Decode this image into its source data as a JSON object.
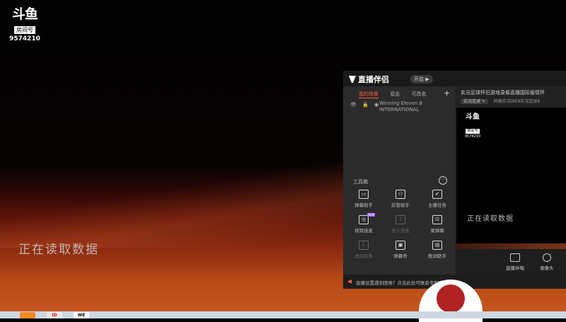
{
  "stream": {
    "logo_glyph": "斗鱼",
    "room_badge": "房间号",
    "room_number": "9574210",
    "loading_text": "正在读取数据"
  },
  "companion": {
    "brand": "直播伴侣",
    "brand_tag": "开启 ▶",
    "tabs": [
      "我的场景",
      "双击",
      "可改名"
    ],
    "add_label": "+",
    "scene_icons": "👁 🔒 ◉",
    "scene_name": "Winning Eleven 8 INTERNATIONAL",
    "toolbox_label": "工具箱",
    "toolbox_more": "···",
    "tools": [
      {
        "label": "弹幕助手",
        "icon": "▭",
        "enabled": true
      },
      {
        "label": "房管助手",
        "icon": "⚇",
        "enabled": true
      },
      {
        "label": "主播任务",
        "icon": "✔",
        "enabled": true
      },
      {
        "label": "视频连麦",
        "icon": "◎",
        "enabled": true,
        "badge": "NEW"
      },
      {
        "label": "多人连麦",
        "icon": "⇩",
        "enabled": false
      },
      {
        "label": "录弹幕",
        "icon": "⊡",
        "enabled": true
      },
      {
        "label": "虚拟形象",
        "icon": "⇩",
        "enabled": false
      },
      {
        "label": "弹幕秀",
        "icon": "▣",
        "enabled": true
      },
      {
        "label": "歌词助手",
        "icon": "▤",
        "enabled": true
      }
    ],
    "notice": "直播设置遇到困难？点击此处可联系专职客服",
    "room_title": "实况足球怀旧游戏录像直播国际版情怀",
    "category_tag": "实况足球 ✎",
    "room_subtitle": "同类实况WE8实况足球8",
    "preview_loading": "正在读取数据",
    "bottom_buttons": [
      "直播伴唱",
      "录像头"
    ]
  },
  "taskbar": {
    "items": [
      "",
      "ID",
      "WE"
    ]
  }
}
